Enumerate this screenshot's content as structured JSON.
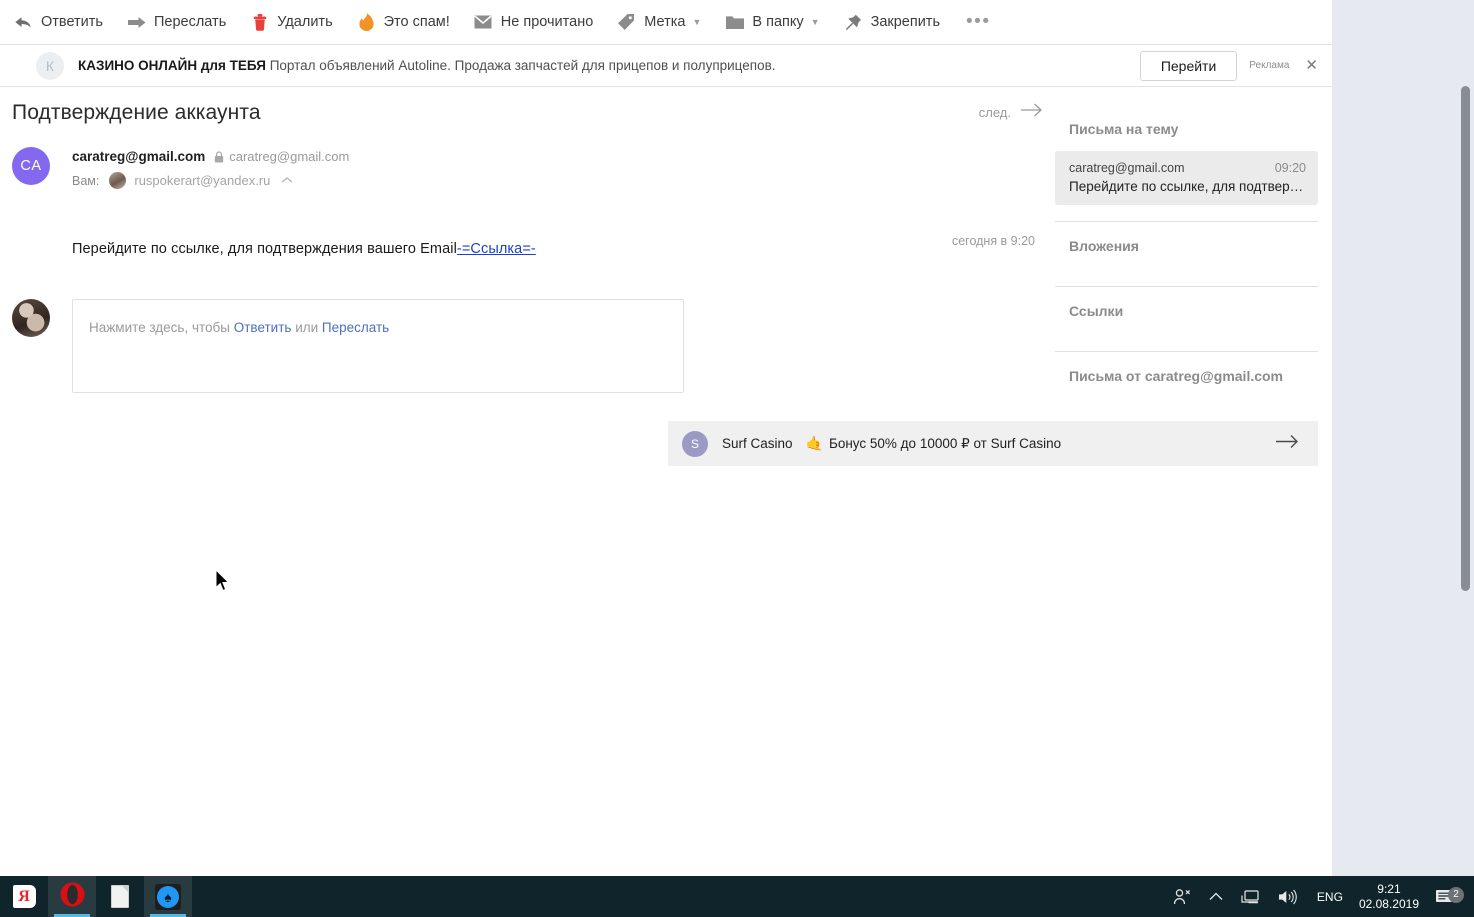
{
  "toolbar": {
    "items": [
      {
        "id": "reply",
        "icon": "reply-arrow-icon",
        "label": "Ответить",
        "caret": false
      },
      {
        "id": "forward",
        "icon": "forward-arrow-icon",
        "label": "Переслать",
        "caret": false
      },
      {
        "id": "delete",
        "icon": "trash-icon",
        "label": "Удалить",
        "caret": false
      },
      {
        "id": "spam",
        "icon": "flame-icon",
        "label": "Это спам!",
        "caret": false
      },
      {
        "id": "unread",
        "icon": "envelope-icon",
        "label": "Не прочитано",
        "caret": false
      },
      {
        "id": "label",
        "icon": "tag-icon",
        "label": "Метка",
        "caret": true
      },
      {
        "id": "folder",
        "icon": "folder-icon",
        "label": "В папку",
        "caret": true
      },
      {
        "id": "pin",
        "icon": "pushpin-icon",
        "label": "Закрепить",
        "caret": false
      }
    ],
    "more_label": "•••"
  },
  "ad": {
    "avatar_letter": "К",
    "title": "КАЗИНО ОНЛАЙН для ТЕБЯ",
    "text": "Портал объявлений Autoline. Продажа запчастей для прицепов и полуприцепов.",
    "button_label": "Перейти",
    "ad_label": "Реклама",
    "close_label": "✕"
  },
  "letter": {
    "subject": "Подтверждение аккаунта",
    "next_label": "след.",
    "avatar_initials": "CA",
    "from_name": "caratreg@gmail.com",
    "from_address": "caratreg@gmail.com",
    "to_label": "Вам:",
    "to_address": "ruspokerart@yandex.ru",
    "date": "сегодня в 9:20",
    "body_text": "Перейдите по ссылке, для подтверждения вашего Email",
    "body_link": "-=Ссылка=-"
  },
  "quick_reply": {
    "prefix": "Нажмите здесь, чтобы ",
    "reply_label": "Ответить",
    "separator": " или ",
    "forward_label": "Переслать"
  },
  "promo": {
    "avatar_letter": "S",
    "name": "Surf Casino",
    "emoji": "🤙",
    "description": "Бонус 50% до 10000 ₽ от Surf Casino"
  },
  "sidebar": {
    "thread_header": "Письма на тему",
    "thread_item": {
      "from": "caratreg@gmail.com",
      "time": "09:20",
      "snippet": "Перейдите по ссылке, для подтвер…"
    },
    "rows": [
      {
        "id": "attachments",
        "label": "Вложения"
      },
      {
        "id": "links",
        "label": "Ссылки"
      },
      {
        "id": "from-sender",
        "label": "Письма от caratreg@gmail.com"
      }
    ]
  },
  "taskbar": {
    "apps": [
      {
        "id": "yandex-browser",
        "icon": "yandex-icon",
        "active": false
      },
      {
        "id": "opera",
        "icon": "opera-icon",
        "active": true
      },
      {
        "id": "document",
        "icon": "document-icon",
        "active": false
      },
      {
        "id": "poker",
        "icon": "spade-icon",
        "active": true
      }
    ],
    "tray": {
      "people_icon": "people-icon",
      "chevron_icon": "chevron-up-icon",
      "network_icon": "network-icon",
      "volume_icon": "volume-icon",
      "language": "ENG",
      "time": "9:21",
      "date": "02.08.2019",
      "notification_count": "2"
    }
  },
  "colors": {
    "accent_purple": "#8468ef",
    "link_blue": "#1a3fd4",
    "action_blue": "#4d6fbd",
    "delete_red": "#e8403a",
    "spam_orange": "#f29326",
    "taskbar_bg": "#10252b",
    "page_bg": "#e6eaf0"
  }
}
